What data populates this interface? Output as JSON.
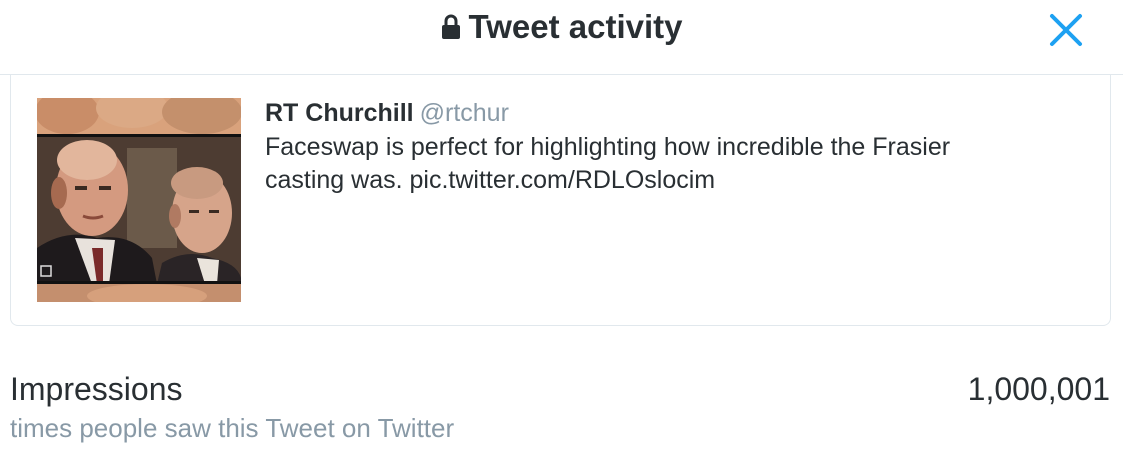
{
  "header": {
    "title": "Tweet activity",
    "lock_icon": "lock-icon",
    "close_icon": "close-icon",
    "accent_color": "#1da1f2"
  },
  "tweet": {
    "author_name": "RT Churchill",
    "author_handle": "@rtchur",
    "text_line1": "Faceswap is perfect for highlighting how incredible the Frasier",
    "text_line2": "casting was. pic.twitter.com/RDLOslocim"
  },
  "metrics": {
    "impressions_label": "Impressions",
    "impressions_desc": "times people saw this Tweet on Twitter",
    "impressions_value": "1,000,001"
  }
}
